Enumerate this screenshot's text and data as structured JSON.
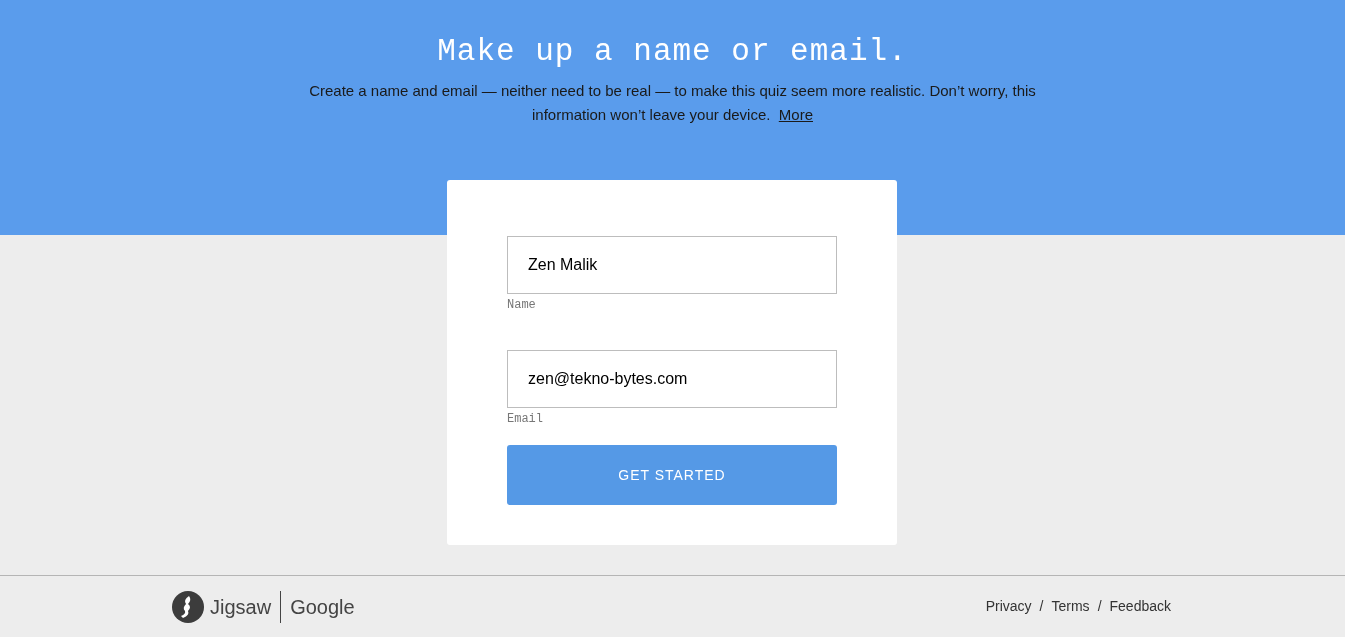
{
  "header": {
    "title": "Make up a name or email.",
    "intro": "Create a name and email — neither need to be real — to make this quiz seem more realistic. Don’t worry, this information won’t leave your device.",
    "more_link": "More"
  },
  "form": {
    "fields": [
      {
        "label": "Name",
        "value": "Zen Malik"
      },
      {
        "label": "Email",
        "value": "zen@tekno-bytes.com"
      }
    ],
    "button": "GET STARTED"
  },
  "footer": {
    "brand": "Jigsaw",
    "partner": "Google",
    "links": [
      "Privacy",
      "Terms",
      "Feedback"
    ],
    "separator": "/"
  }
}
